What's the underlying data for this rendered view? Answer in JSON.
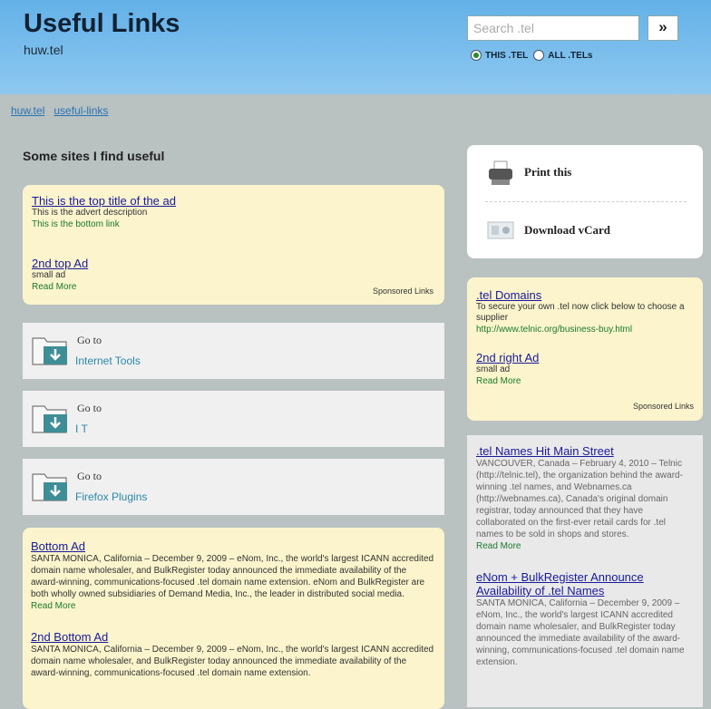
{
  "header": {
    "title": "Useful Links",
    "subtitle": "huw.tel",
    "search": {
      "placeholder": "Search .tel",
      "button_label": "»"
    },
    "scope": {
      "option1": "THIS .TEL",
      "option2": "ALL .TELs",
      "selected": "THIS .TEL"
    }
  },
  "breadcrumb": {
    "item1": "huw.tel",
    "item2": "useful-links"
  },
  "main": {
    "heading": "Some sites I find useful",
    "top_ads": {
      "ad1": {
        "title": "This is the top title of the ad",
        "desc": "This is the advert description",
        "link": "This is the bottom link"
      },
      "ad2": {
        "title": "2nd top Ad",
        "desc": "small ad",
        "link": "Read More"
      },
      "sponsored": "Sponsored Links"
    },
    "goto": [
      {
        "label": "Go to",
        "target": "Internet Tools"
      },
      {
        "label": "Go to",
        "target": "I T"
      },
      {
        "label": "Go to",
        "target": "Firefox Plugins"
      }
    ],
    "bottom_ads": {
      "ad1": {
        "title": "Bottom Ad",
        "body": "SANTA MONICA, California – December 9, 2009 – eNom, Inc., the world's largest ICANN accredited domain name wholesaler, and BulkRegister today announced the immediate availability of the award-winning, communications-focused .tel domain name extension. eNom and BulkRegister are both wholly owned subsidiaries of Demand Media, Inc., the leader in distributed social media.",
        "link": "Read More"
      },
      "ad2": {
        "title": "2nd Bottom Ad",
        "body": "SANTA MONICA, California – December 9, 2009 – eNom, Inc., the world's largest ICANN accredited domain name wholesaler, and BulkRegister today announced the immediate availability of the award-winning, communications-focused .tel domain name extension."
      }
    }
  },
  "sidebar": {
    "print_label": "Print this",
    "vcard_label": "Download vCard",
    "ads": {
      "ad1": {
        "title": ".tel Domains",
        "desc": "To secure your own .tel now click below to choose a supplier",
        "link": "http://www.telnic.org/business-buy.html"
      },
      "ad2": {
        "title": "2nd right Ad",
        "desc": "small ad",
        "link": "Read More"
      },
      "sponsored": "Sponsored Links"
    },
    "news": [
      {
        "title": ".tel Names Hit Main Street",
        "body": "VANCOUVER, Canada – February 4, 2010 – Telnic (http://telnic.tel), the organization behind the award-winning .tel names, and Webnames.ca (http://webnames.ca), Canada's original domain registrar, today announced that they have collaborated on the first-ever retail cards for .tel names to be sold in shops and stores.",
        "link": "Read More"
      },
      {
        "title": "eNom + BulkRegister Announce Availability of .tel Names",
        "body": "SANTA MONICA, California – December 9, 2009 – eNom, Inc., the world's largest ICANN accredited domain name wholesaler, and BulkRegister today announced the immediate availability of the award-winning, communications-focused .tel domain name extension."
      }
    ]
  },
  "colors": {
    "header": "#63b1e8",
    "ad_bg": "#fbf4cc",
    "link": "#1a1a9c",
    "green_link": "#1c7a2c",
    "folder": "#3f8d96"
  }
}
